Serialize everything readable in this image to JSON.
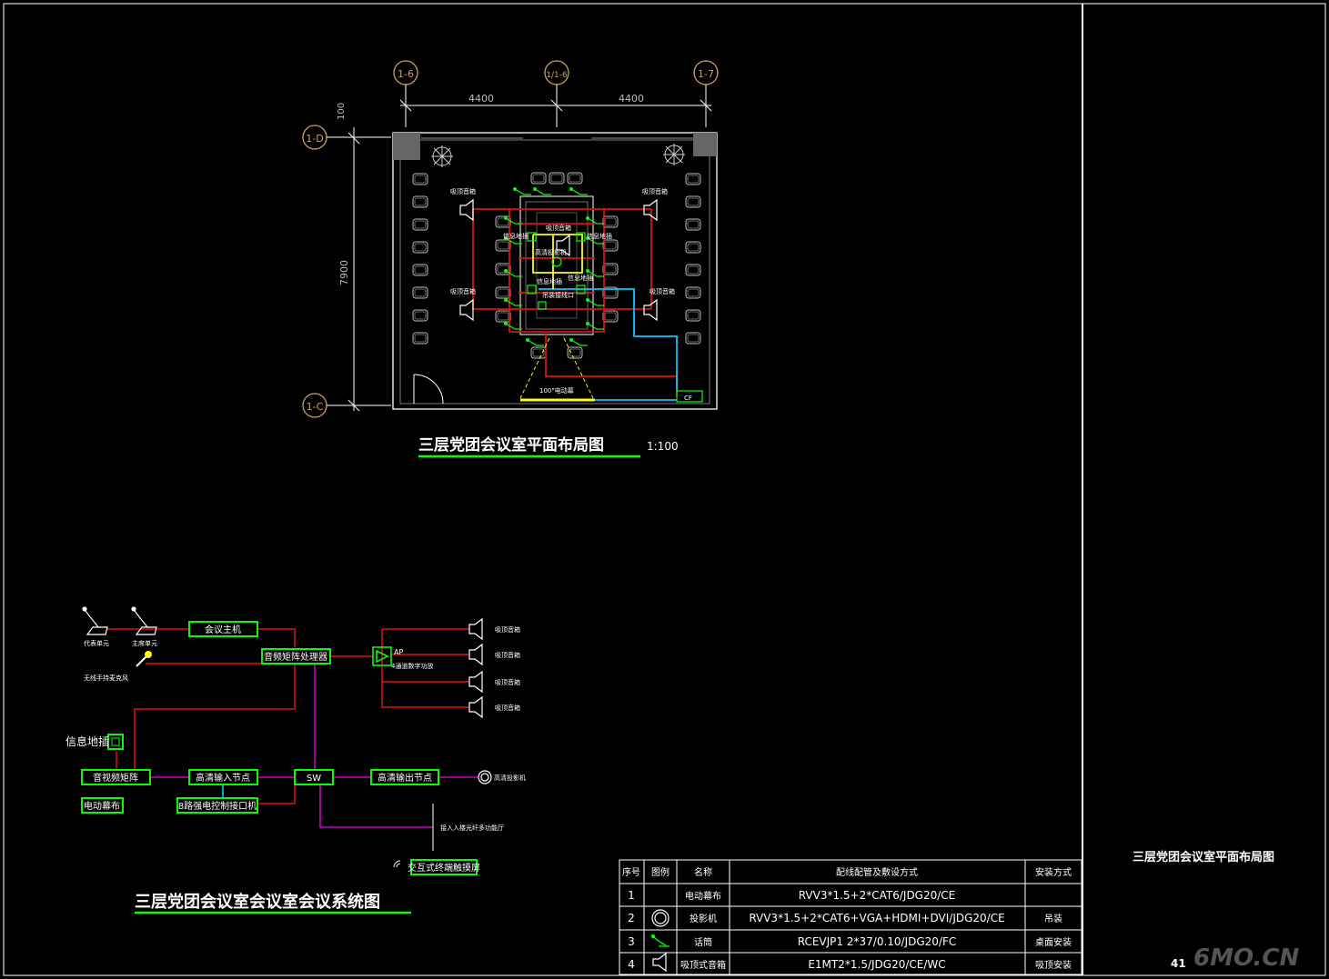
{
  "titles": {
    "plan": "三层党团会议室平面布局图",
    "plan_scale": "1:100",
    "system": "三层党团会议室会议室会议系统图",
    "sheet": "三层党团会议室平面布局图",
    "sheet_no": "41",
    "watermark": "6MO.CN"
  },
  "plan": {
    "axes": [
      "1-6",
      "1/1-6",
      "1-7",
      "1-D",
      "1-C"
    ],
    "dims": [
      "4400",
      "4400",
      "100",
      "7900"
    ],
    "labels": {
      "spk_tl": "吸顶音箱",
      "spk_tr": "吸顶音箱",
      "spk_ml": "吸顶音箱",
      "spk_mr": "吸顶音箱",
      "spk_center": "吸顶音箱",
      "info_l": "信息地插",
      "info_r": "信息地插",
      "projector": "高清投影机",
      "info_bl": "信息地插",
      "info_br": "信息地插",
      "ctrl": "吊装接线口",
      "screen": "100\"电动幕",
      "cf": "CF"
    }
  },
  "system": {
    "mic1": "代表单元",
    "mic2": "主席单元",
    "wireless": "无线手持麦克风",
    "host": "会议主机",
    "matrix": "音频矩阵处理器",
    "amp": "AP",
    "amp_label": "4通道数字功放",
    "spk": [
      "吸顶音箱",
      "吸顶音箱",
      "吸顶音箱",
      "吸顶音箱"
    ],
    "info": "信息地插",
    "av_matrix": "音视频矩阵",
    "hd_in": "高清输入节点",
    "sw": "SW",
    "hd_out": "高清输出节点",
    "projector": "高清投影机",
    "screen": "电动幕布",
    "relay": "8路强电控制接口机",
    "net": "接入入楼光纤多功能厅",
    "touch": "交互式终端触摸屏"
  },
  "legend": {
    "headers": [
      "序号",
      "图例",
      "名称",
      "配线配管及敷设方式",
      "安装方式"
    ],
    "rows": [
      {
        "no": "1",
        "name": "电动幕布",
        "spec": "RVV3*1.5+2*CAT6/JDG20/CE",
        "install": ""
      },
      {
        "no": "2",
        "name": "投影机",
        "spec": "RVV3*1.5+2*CAT6+VGA+HDMI+DVI/JDG20/CE",
        "install": "吊装"
      },
      {
        "no": "3",
        "name": "话筒",
        "spec": "RCEVJP1  2*37/0.10/JDG20/FC",
        "install": "桌面安装"
      },
      {
        "no": "4",
        "name": "吸顶式音箱",
        "spec": "E1MT2*1.5/JDG20/CE/WC",
        "install": "吸顶安装"
      }
    ]
  }
}
